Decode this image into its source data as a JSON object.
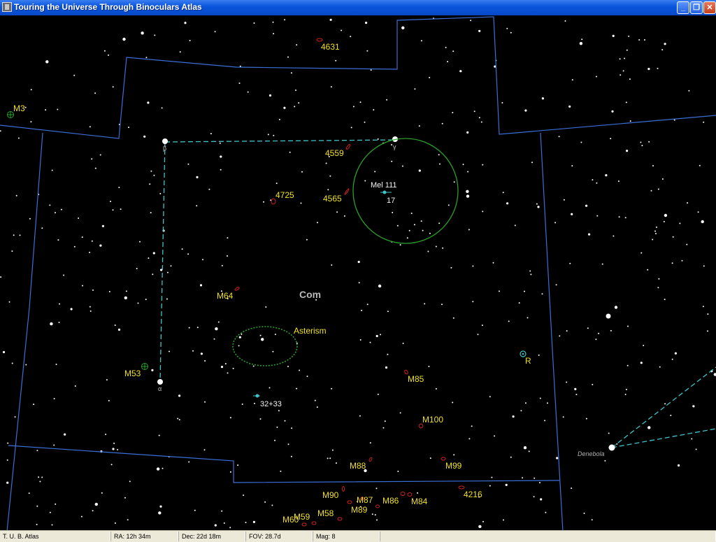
{
  "window": {
    "title": "Touring the Universe Through Binoculars Atlas",
    "minimize_glyph": "_",
    "maximize_glyph": "❐",
    "close_glyph": "✕"
  },
  "status": {
    "app": "T. U. B. Atlas",
    "ra": "RA: 12h 34m",
    "dec": "Dec: 22d 18m",
    "fov": "FOV: 28.7d",
    "mag": "Mag: 8"
  },
  "colors": {
    "background": "#000000",
    "boundary": "#3b6fd8",
    "figure": "#3fc4c8",
    "label": "#f0e020",
    "galaxy": "#d02020",
    "cluster": "#2aa02a"
  },
  "labels": {
    "constellation": "Com",
    "asterism": "Asterism",
    "mel111": "Mel 111",
    "star17": "17",
    "star3233": "32+33",
    "var_r": "R",
    "denebola": "Denebola",
    "beta": "β",
    "alpha": "α",
    "gamma": "γ",
    "m3": "M3",
    "m53": "M53",
    "m64": "M64",
    "m85": "M85",
    "m100": "M100",
    "m88": "M88",
    "m99": "M99",
    "m90": "M90",
    "m87": "M87",
    "m86": "M86",
    "m84": "M84",
    "m89": "M89",
    "m58": "M58",
    "m59": "M59",
    "m60": "M60",
    "ngc4631": "4631",
    "ngc4559": "4559",
    "ngc4725": "4725",
    "ngc4565": "4565",
    "ngc4216": "4216"
  }
}
